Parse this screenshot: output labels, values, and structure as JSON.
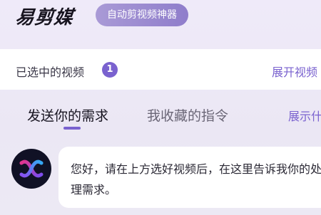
{
  "header": {
    "logo_text": "易剪媒",
    "tagline": "自动剪视频神器"
  },
  "selected_bar": {
    "label": "已选中的视频",
    "count": "1",
    "expand_label": "展开视频"
  },
  "tabs": [
    {
      "label": "发送你的需求"
    },
    {
      "label": "我收藏的指令"
    },
    {
      "label": "展示什"
    }
  ],
  "chat": {
    "assistant_message": "您好，请在上方选好视频后，在这里告诉我你的处理需求。"
  },
  "colors": {
    "accent": "#7a62cf",
    "tagline_bg": "#9b8bd2",
    "avatar_bg": "#101125"
  }
}
